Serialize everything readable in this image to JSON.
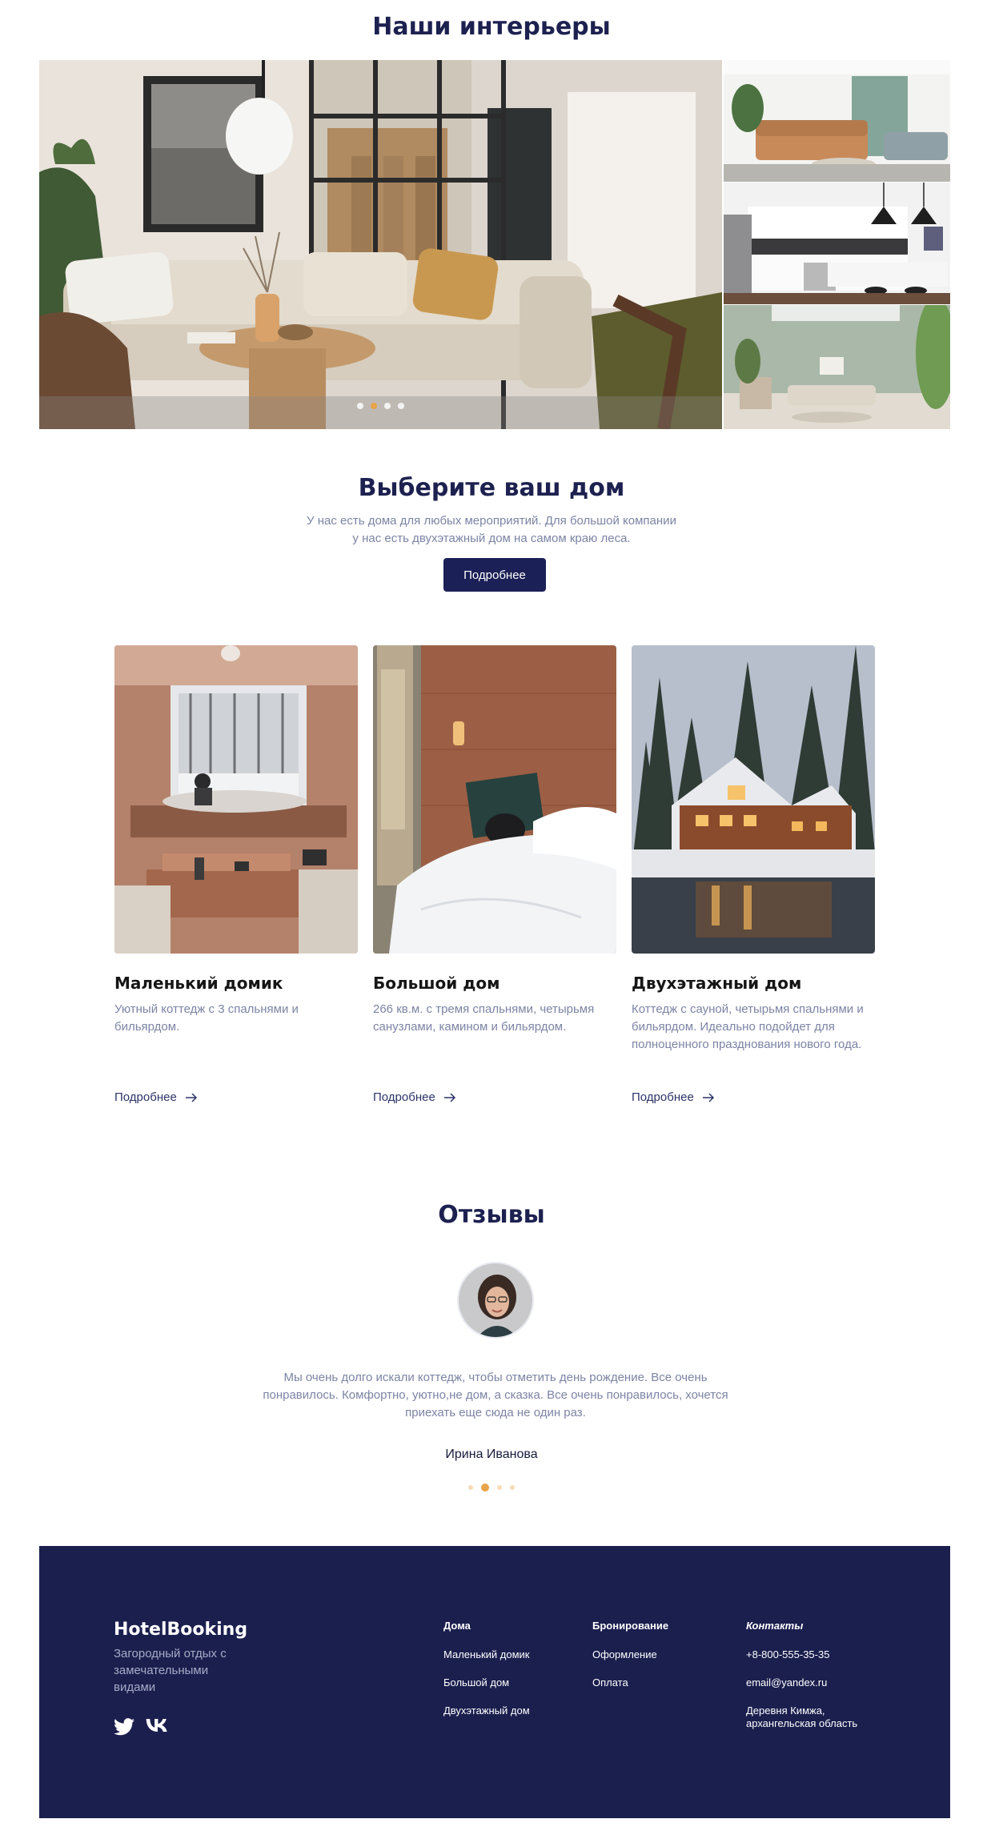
{
  "interiors": {
    "title": "Наши интерьеры",
    "slider_dots": [
      false,
      true,
      false,
      false
    ]
  },
  "choose": {
    "title": "Выберите ваш дом",
    "text_line1": "У нас есть дома для любых мероприятий. Для большой компании",
    "text_line2": "у нас есть двухэтажный дом на самом краю леса.",
    "button_label": "Подробнее"
  },
  "houses": [
    {
      "title": "Маленький домик",
      "description": "Уютный коттедж с 3 спальнями и бильярдом.",
      "link_label": "Подробнее"
    },
    {
      "title": "Большой дом",
      "description": "266 кв.м. с тремя спальнями, четырьмя санузлами, камином и бильярдом.",
      "link_label": "Подробнее"
    },
    {
      "title": "Двухэтажный дом",
      "description": "Коттедж с сауной, четырьмя спальнями и бильярдом. Идеально подойдет для полноценного празднования нового года.",
      "link_label": "Подробнее"
    }
  ],
  "reviews": {
    "title": "Отзывы",
    "text_line1": "Мы очень долго искали коттедж, чтобы отметить день рождение. Все очень",
    "text_line2": "понравилось. Комфортно, уютно,не дом, а сказка. Все очень понравилось, хочется",
    "text_line3": "приехать еще сюда не один раз.",
    "author": "Ирина Иванова",
    "dots": [
      false,
      true,
      false,
      false
    ]
  },
  "footer": {
    "brand": "HotelBooking",
    "tagline": "Загородный отдых с замечательными видами",
    "socials": [
      "twitter-icon",
      "vk-icon"
    ],
    "columns": [
      {
        "heading": "Дома",
        "items": [
          "Маленький домик",
          "Большой дом",
          "Двухэтажный дом"
        ]
      },
      {
        "heading": "Бронирование",
        "items": [
          "Оформление",
          "Оплата"
        ]
      },
      {
        "heading": "Контакты",
        "items": [
          "+8-800-555-35-35",
          "email@yandex.ru",
          "Деревня Кимжа, архангельская область"
        ]
      }
    ]
  },
  "colors": {
    "navy": "#1b1f4e",
    "accent_dot": "#e8a44a",
    "muted_text": "#7c84a4"
  }
}
